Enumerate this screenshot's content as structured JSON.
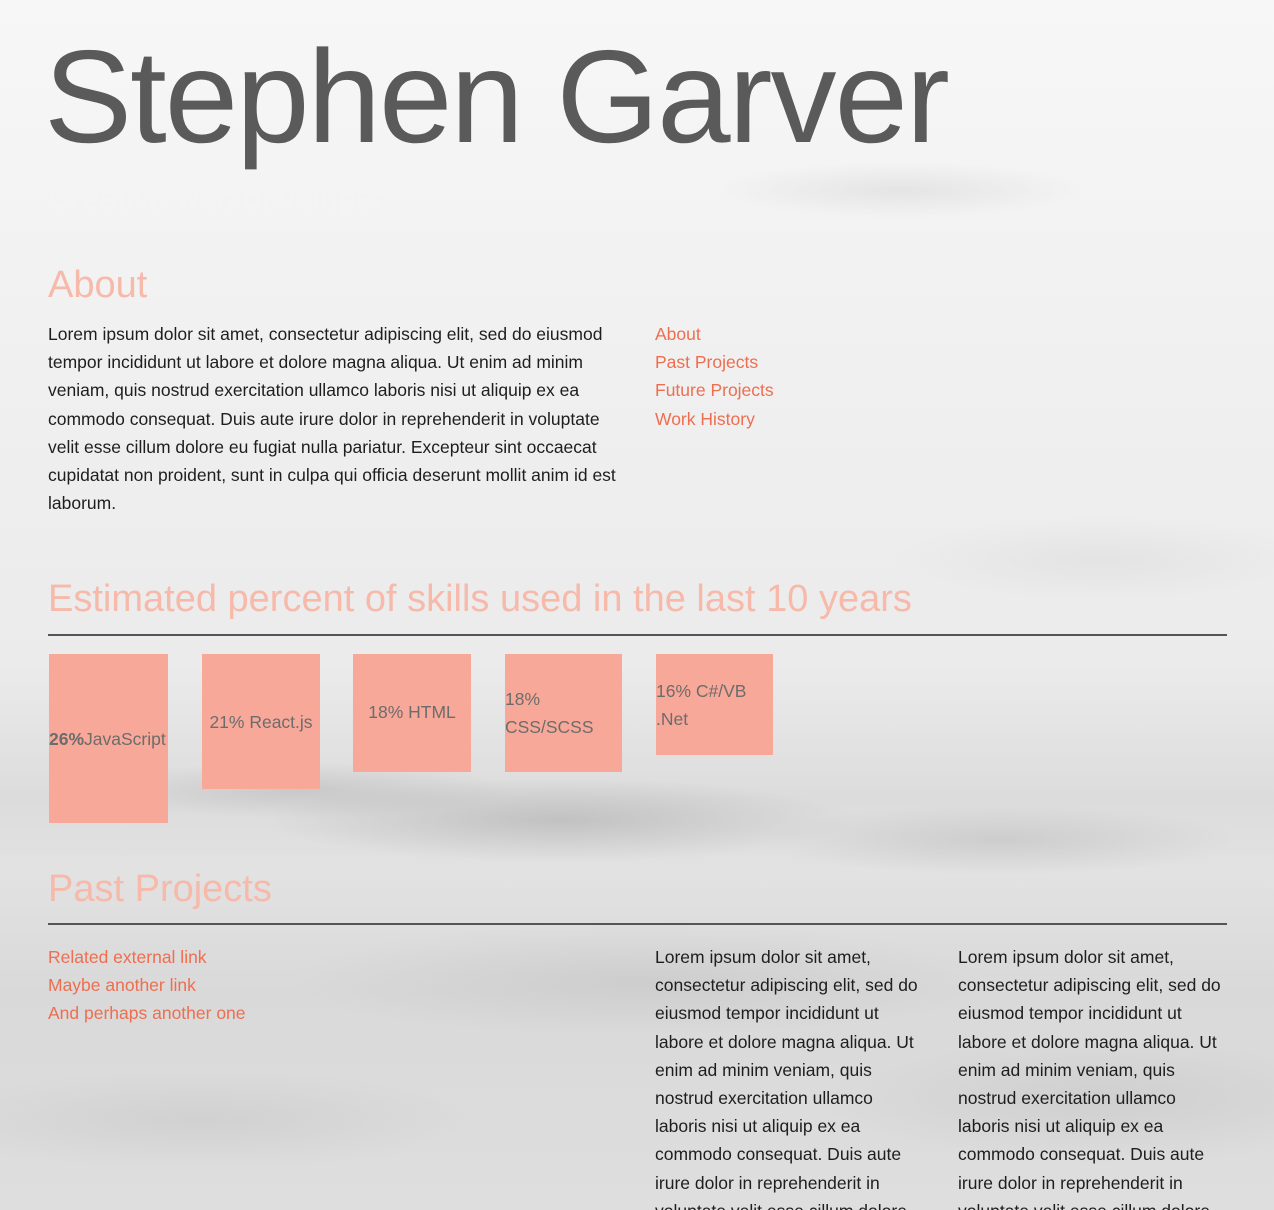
{
  "header": {
    "name": "Stephen Garver",
    "tagline": "Creative web developer"
  },
  "about": {
    "title": "About",
    "text": "Lorem ipsum dolor sit amet, consectetur adipiscing elit, sed do eiusmod tempor incididunt ut labore et dolore magna aliqua. Ut enim ad minim veniam, quis nostrud exercitation ullamco laboris nisi ut aliquip ex ea commodo consequat. Duis aute irure dolor in reprehenderit in voluptate velit esse cillum dolore eu fugiat nulla pariatur. Excepteur sint occaecat cupidatat non proident, sunt in culpa qui officia deserunt mollit anim id est laborum."
  },
  "nav": {
    "items": [
      {
        "label": "About"
      },
      {
        "label": "Past Projects"
      },
      {
        "label": "Future Projects"
      },
      {
        "label": "Work History"
      }
    ]
  },
  "skills": {
    "title": "Estimated percent of skills used in the last 10 years",
    "items": [
      {
        "pct": "26%",
        "name": "JavaScript"
      },
      {
        "label": "21% React.js"
      },
      {
        "label": "18% HTML"
      },
      {
        "label": "18% CSS/SCSS"
      },
      {
        "label": "16% C#/VB .Net"
      }
    ],
    "color": "#f8a899"
  },
  "past_projects": {
    "title": "Past Projects",
    "links": [
      {
        "label": "Related external link"
      },
      {
        "label": "Maybe another link"
      },
      {
        "label": "And perhaps another one"
      }
    ],
    "col1_text": "Lorem ipsum dolor sit amet, consectetur adipiscing elit, sed do eiusmod tempor incididunt ut labore et dolore magna aliqua. Ut enim ad minim veniam, quis nostrud exercitation ullamco laboris nisi ut aliquip ex ea commodo consequat. Duis aute irure dolor in reprehenderit in voluptate velit esse cillum dolore",
    "col2_text": "Lorem ipsum dolor sit amet, consectetur adipiscing elit, sed do eiusmod tempor incididunt ut labore et dolore magna aliqua. Ut enim ad minim veniam, quis nostrud exercitation ullamco laboris nisi ut aliquip ex ea commodo consequat. Duis aute irure dolor in reprehenderit in voluptate velit esse cillum dolore"
  },
  "colors": {
    "accent": "#ee6e50",
    "heading": "#f7b9a9",
    "name": "#5a5a5a"
  }
}
